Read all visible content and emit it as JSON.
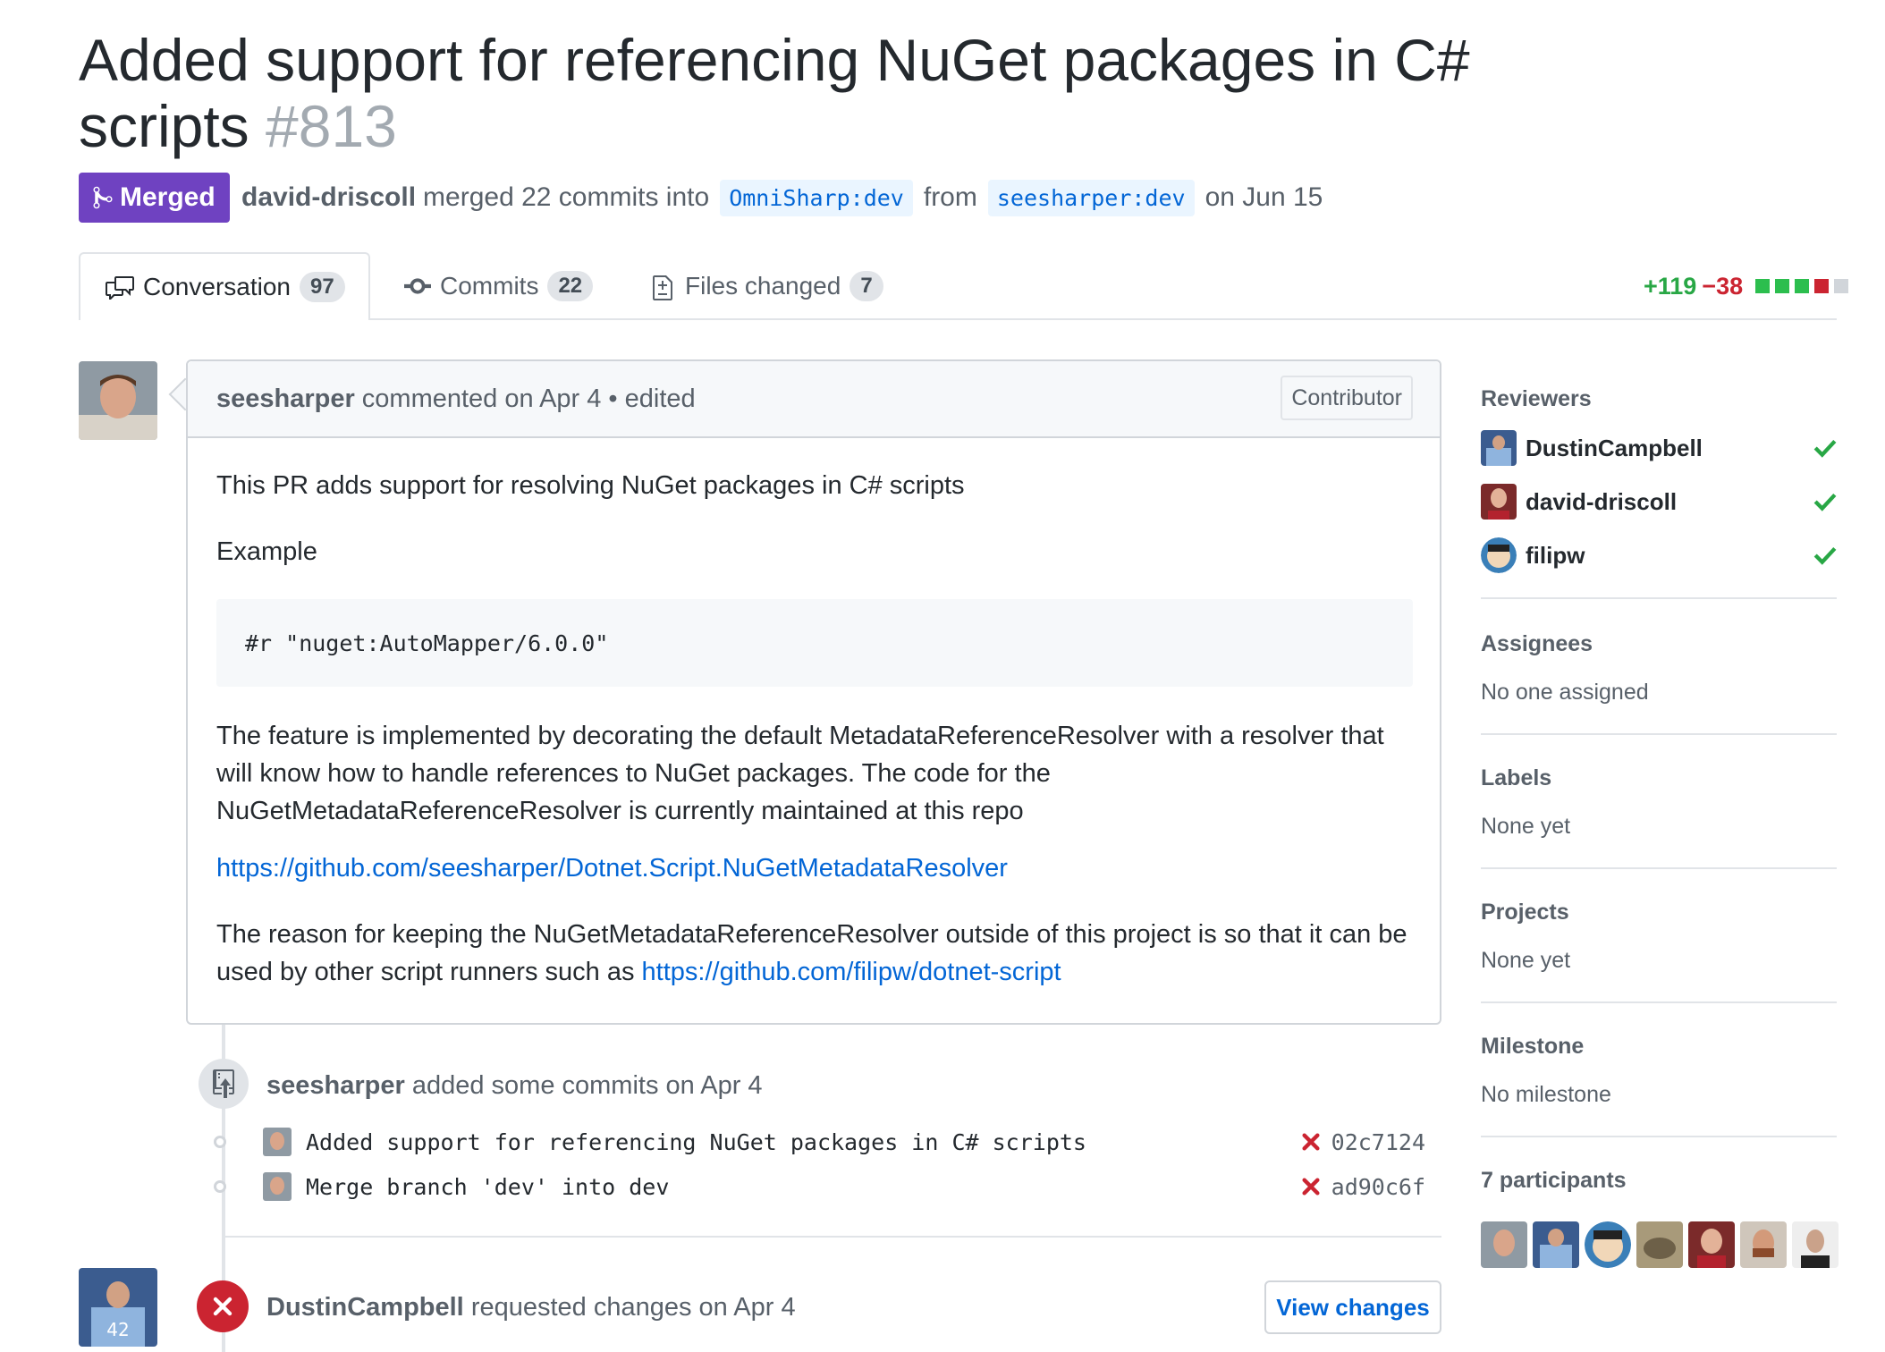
{
  "pr": {
    "title": "Added support for referencing NuGet packages in C# scripts",
    "number": "#813",
    "state": "Merged",
    "merged_by": "david-driscoll",
    "merge_text": "merged 22 commits into",
    "base_branch": "OmniSharp:dev",
    "from_text": "from",
    "head_branch": "seesharper:dev",
    "date_text": "on Jun 15"
  },
  "tabs": [
    {
      "label": "Conversation",
      "count": "97"
    },
    {
      "label": "Commits",
      "count": "22"
    },
    {
      "label": "Files changed",
      "count": "7"
    }
  ],
  "diffstat": {
    "additions": "+119",
    "deletions": "−38"
  },
  "comment": {
    "author": "seesharper",
    "meta": "commented on Apr 4 • edited",
    "role": "Contributor",
    "p1": "This PR adds support for resolving NuGet packages in C# scripts",
    "p2": "Example",
    "code": "#r \"nuget:AutoMapper/6.0.0\"",
    "p3_line1": "The feature is implemented by decorating the default MetadataReferenceResolver with a resolver that",
    "p3_line2": "will know how to handle references to NuGet packages. The code for the",
    "p3_line3": "NuGetMetadataReferenceResolver is currently maintained at this repo",
    "link1": "https://github.com/seesharper/Dotnet.Script.NuGetMetadataResolver",
    "p4_line1": "The reason for keeping the NuGetMetadataReferenceResolver outside of this project is so that it can be",
    "p4_line2_prefix": "used by other script runners such as",
    "link2": "https://github.com/filipw/dotnet-script"
  },
  "commit_event": {
    "author": "seesharper",
    "text": "added some commits on Apr 4",
    "commits": [
      {
        "message": "Added support for referencing NuGet packages in C# scripts",
        "sha": "02c7124"
      },
      {
        "message": "Merge branch 'dev' into dev",
        "sha": "ad90c6f"
      }
    ]
  },
  "review_event": {
    "author": "DustinCampbell",
    "text": "requested changes on Apr 4",
    "button": "View changes"
  },
  "sidebar": {
    "reviewers_title": "Reviewers",
    "reviewers": [
      "DustinCampbell",
      "david-driscoll",
      "filipw"
    ],
    "assignees_title": "Assignees",
    "assignees_value": "No one assigned",
    "labels_title": "Labels",
    "labels_value": "None yet",
    "projects_title": "Projects",
    "projects_value": "None yet",
    "milestone_title": "Milestone",
    "milestone_value": "No milestone",
    "participants_title": "7 participants"
  },
  "colors": {
    "merged": "#6f42c1",
    "link": "#0366d6",
    "addition": "#28a745",
    "deletion": "#cb2431"
  }
}
